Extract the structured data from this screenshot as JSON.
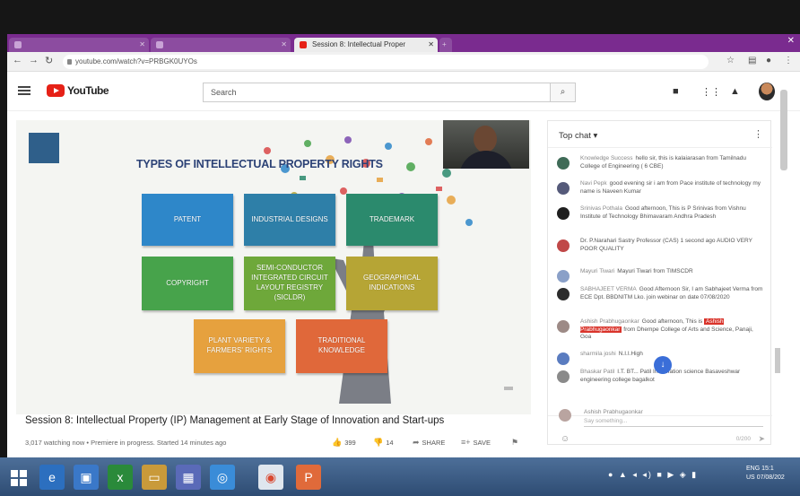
{
  "browser": {
    "tabs": [
      {
        "label": "",
        "active": false
      },
      {
        "label": "",
        "active": false
      },
      {
        "label": "Session 8: Intellectual Proper",
        "active": true
      }
    ],
    "url": "youtube.com/watch?v=PRBGK0UYOs"
  },
  "youtube": {
    "logo_text": "YouTube",
    "search_placeholder": "Search"
  },
  "slide": {
    "logo_text": "",
    "title": "TYPES OF INTELLECTUAL PROPERTY RIGHTS",
    "boxes": [
      {
        "label": "PATENT",
        "color": "#2e87c9"
      },
      {
        "label": "INDUSTRIAL DESIGNS",
        "color": "#2e7fa8"
      },
      {
        "label": "TRADEMARK",
        "color": "#2b8a6d"
      },
      {
        "label": "COPYRIGHT",
        "color": "#47a34b"
      },
      {
        "label": "SEMI-CONDUCTOR INTEGRATED CIRCUIT LAYOUT REGISTRY (SICLDR)",
        "color": "#6ea83a"
      },
      {
        "label": "GEOGRAPHICAL INDICATIONS",
        "color": "#b6a535"
      },
      {
        "label": "PLANT VARIETY & FARMERS' RIGHTS",
        "color": "#e6a13e"
      },
      {
        "label": "TRADITIONAL KNOWLEDGE",
        "color": "#e0683a"
      }
    ]
  },
  "video": {
    "title": "Session 8: Intellectual Property (IP) Management at Early Stage of Innovation and Start-ups",
    "meta": "3,017 watching now • Premiere in progress. Started 14 minutes ago",
    "likes": "399",
    "dislikes": "14",
    "share_label": "SHARE",
    "save_label": "SAVE"
  },
  "chat": {
    "header": "Top chat",
    "messages": [
      {
        "name": "Knowledge Success",
        "text": "hello sir, this is kalaiarasan from Tamilnadu College of Engineering ( 6 CBE)",
        "avatar_color": "#3f6b57"
      },
      {
        "name": "Navi Pepk",
        "text": "good evening sir i am from Pace institute of technology my name is Naveen Kumar",
        "avatar_color": "#555a7a"
      },
      {
        "name": "Srinivas Pothala",
        "text": "Good afternoon, This is P Srinivas from Vishnu Institute of Technology Bhimavaram Andhra Pradesh",
        "avatar_color": "#1f1f1f"
      },
      {
        "name": "Dr. P.Narahari Sastry Professor (CAS)",
        "text": "Dr. P.Narahari Sastry Professor (CAS) 1 second ago AUDIO VERY POOR QUALITY",
        "avatar_color": "#c04848"
      },
      {
        "name": "Mayuri Tiwari",
        "text": "Mayuri Tiwari from TIMSCDR",
        "avatar_color": "#8aa0c8"
      },
      {
        "name": "SABHAJEET VERMA",
        "text": "Good Afternoon Sir, I am Sabhajeet Verma from ECE Dpt. BBDNITM Lko. join webinar on date 07/08/2020",
        "avatar_color": "#2c2c2c"
      },
      {
        "name": "Ashish Prabhugaonkar",
        "text": "Good afternoon, This is",
        "highlight": "Ashish Prabhugaonkar",
        "text2": "from Dhempe College of Arts and Science, Panaji, Goa",
        "avatar_color": "#9d8a86"
      },
      {
        "name": "sharmila joshi",
        "text": "N.I.I.High",
        "avatar_color": "#5a7cc0"
      },
      {
        "name": "Bhaskar Patil",
        "text": "I.T. BT... Patil Information science Basaveshwar engineering college bagalkot",
        "avatar_color": "#8a8a8a"
      }
    ],
    "current_user": "Ashish Prabhugaonkar",
    "input_placeholder": "Say something...",
    "char_count": "0/200"
  },
  "taskbar": {
    "clock_time": "15:1",
    "clock_lang": "ENG",
    "clock_region": "US",
    "clock_date": "07/08/202"
  }
}
